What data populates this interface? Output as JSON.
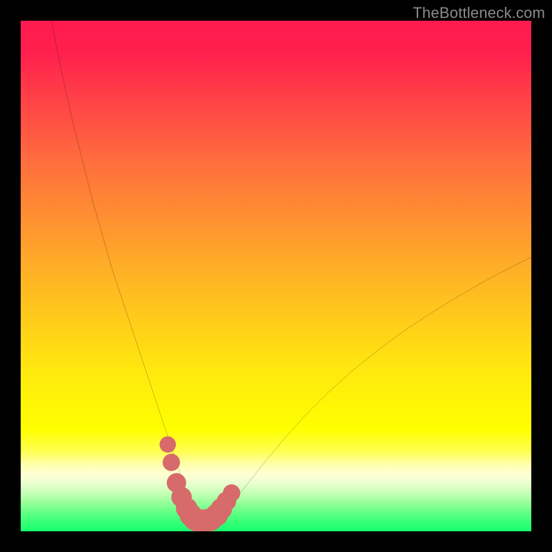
{
  "watermark": "TheBottleneck.com",
  "chart_data": {
    "type": "line",
    "title": "",
    "xlabel": "",
    "ylabel": "",
    "xlim": [
      0,
      100
    ],
    "ylim": [
      0,
      100
    ],
    "gradient_stops": [
      {
        "offset": 0.0,
        "color": "#ff1a4f"
      },
      {
        "offset": 0.06,
        "color": "#ff1f4e"
      },
      {
        "offset": 0.28,
        "color": "#ff6f3d"
      },
      {
        "offset": 0.5,
        "color": "#ffb325"
      },
      {
        "offset": 0.68,
        "color": "#ffe70f"
      },
      {
        "offset": 0.8,
        "color": "#ffff00"
      },
      {
        "offset": 0.845,
        "color": "#ffff55"
      },
      {
        "offset": 0.868,
        "color": "#ffffaa"
      },
      {
        "offset": 0.888,
        "color": "#ffffd5"
      },
      {
        "offset": 0.906,
        "color": "#eaffd0"
      },
      {
        "offset": 0.924,
        "color": "#c8ffb8"
      },
      {
        "offset": 0.942,
        "color": "#9cff9c"
      },
      {
        "offset": 0.96,
        "color": "#6cff88"
      },
      {
        "offset": 0.98,
        "color": "#3aff78"
      },
      {
        "offset": 1.0,
        "color": "#18ff6e"
      }
    ],
    "series": [
      {
        "name": "bottleneck-curve",
        "stroke": "#000000",
        "x": [
          6,
          8,
          10,
          12,
          14,
          16,
          18,
          20,
          22,
          24,
          26,
          28,
          29,
          30,
          31,
          32,
          33,
          34,
          35,
          36,
          37,
          38,
          40,
          42,
          45,
          48,
          52,
          56,
          60,
          65,
          70,
          75,
          80,
          85,
          90,
          95,
          100
        ],
        "y": [
          100,
          90,
          81,
          73,
          65,
          58,
          51,
          45,
          39,
          33,
          27,
          21,
          18,
          15,
          12,
          9,
          6.5,
          4.3,
          2.8,
          2.0,
          2.0,
          2.4,
          4.0,
          6.3,
          10.0,
          13.8,
          18.6,
          23.0,
          27.0,
          31.5,
          35.5,
          39.2,
          42.5,
          45.6,
          48.5,
          51.2,
          53.7
        ]
      },
      {
        "name": "highlight-dots",
        "stroke": "#d76a6a",
        "type": "scatter",
        "x": [
          28.8,
          29.5,
          30.5,
          31.5,
          32.5,
          33.3,
          34.1,
          35.0,
          36.0,
          37.2,
          38.4,
          39.3,
          40.3,
          41.3
        ],
        "y": [
          17.0,
          13.5,
          9.5,
          6.7,
          4.5,
          3.2,
          2.4,
          2.0,
          2.0,
          2.3,
          3.2,
          4.4,
          5.9,
          7.5
        ],
        "r": [
          1.6,
          1.7,
          1.9,
          2.0,
          2.1,
          2.2,
          2.25,
          2.3,
          2.3,
          2.25,
          2.2,
          2.1,
          1.9,
          1.7
        ]
      }
    ]
  }
}
